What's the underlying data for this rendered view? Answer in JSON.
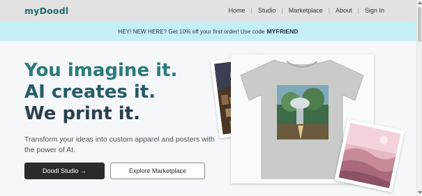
{
  "header": {
    "logo": "myDoodl",
    "nav": [
      {
        "label": "Home"
      },
      {
        "label": "Studio"
      },
      {
        "label": "Marketplace"
      },
      {
        "label": "About"
      },
      {
        "label": "Sign In"
      }
    ],
    "separator": "|"
  },
  "promo": {
    "text": "HEY! NEW HERE? Get 10% off your first order! Use code",
    "code": "MYFRIEND"
  },
  "hero": {
    "headline": [
      "You imagine it.",
      "AI creates it.",
      "We print it."
    ],
    "subtitle": "Transform your ideas into custom apparel and posters with the power of AI.",
    "primary_button": "Doodl Studio →",
    "secondary_button": "Explore Marketplace"
  },
  "colors": {
    "brand": "#1d6b6a",
    "headline_line1": "#2a7b78",
    "headline_line2": "#245b68",
    "headline_line3": "#2b3f4e",
    "header_bg": "#e2e2e2",
    "promo_bg": "#c6eef6",
    "primary_button_bg": "#2b2b2b"
  },
  "images": {
    "left_photo": "moon-portal-poster",
    "center_product": "tshirt-with-fantasy-forest-print",
    "right_photo": "pink-desert-sky-poster"
  }
}
